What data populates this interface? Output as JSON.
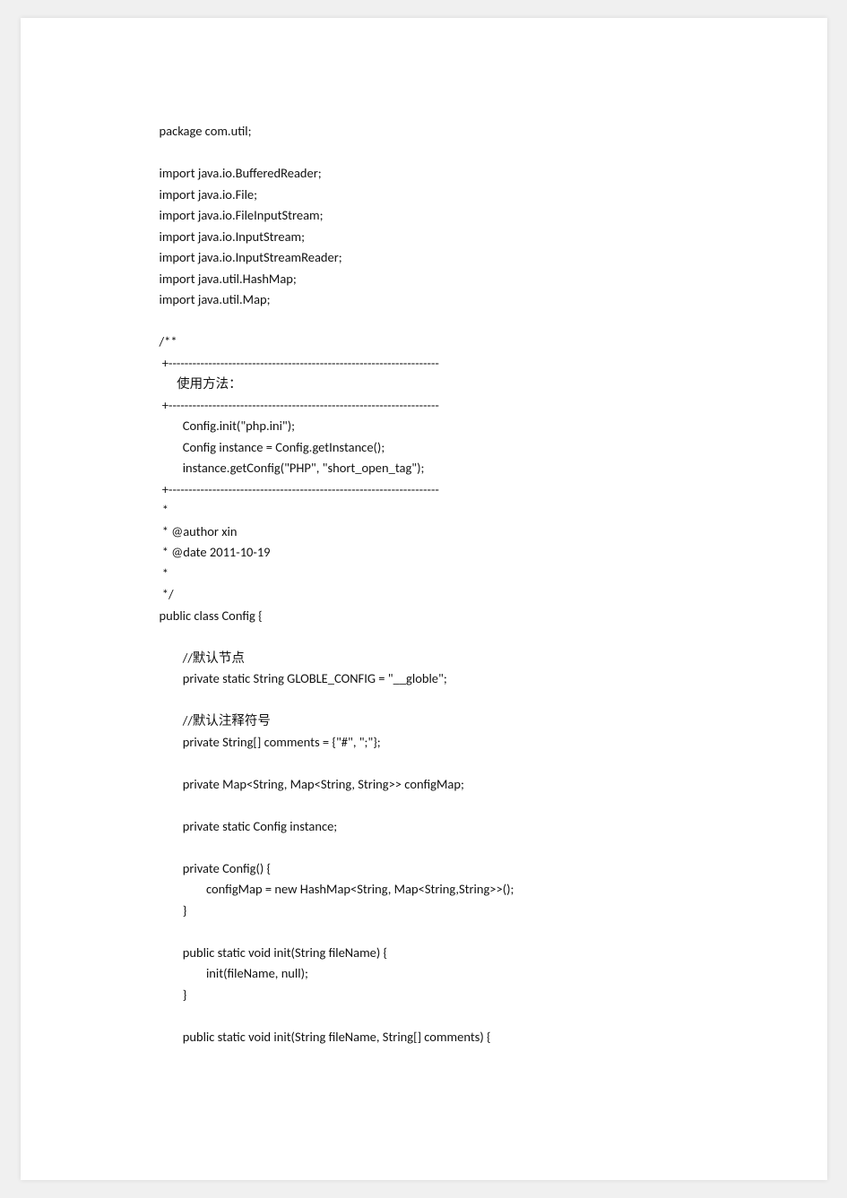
{
  "lines": [
    "package com.util;",
    "",
    "import java.io.BufferedReader;",
    "import java.io.File;",
    "import java.io.FileInputStream;",
    "import java.io.InputStream;",
    "import java.io.InputStreamReader;",
    "import java.util.HashMap;",
    "import java.util.Map;",
    "",
    "/**",
    " +--------------------------------------------------------------------",
    "      使用方法：",
    " +--------------------------------------------------------------------",
    "        Config.init(\"php.ini\");",
    "        Config instance = Config.getInstance();",
    "        instance.getConfig(\"PHP\", \"short_open_tag\");",
    " +--------------------------------------------------------------------",
    " * ",
    " * @author xin",
    " * @date 2011-10-19",
    " *",
    " */",
    "public class Config {",
    "",
    "        //默认节点",
    "        private static String GLOBLE_CONFIG = \"__globle\";",
    "",
    "        //默认注释符号",
    "        private String[] comments = {\"#\", \";\"};",
    "",
    "        private Map<String, Map<String, String>> configMap;",
    "",
    "        private static Config instance;",
    "",
    "        private Config() {",
    "                configMap = new HashMap<String, Map<String,String>>();",
    "        }",
    "",
    "        public static void init(String fileName) {",
    "                init(fileName, null);",
    "        }",
    "",
    "        public static void init(String fileName, String[] comments) {"
  ]
}
